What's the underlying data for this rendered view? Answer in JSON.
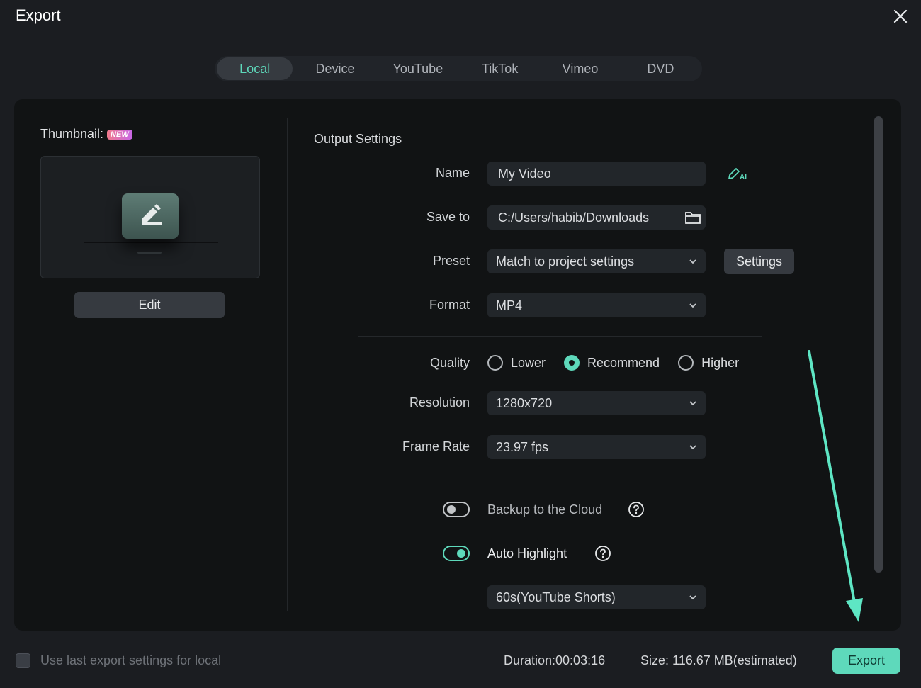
{
  "window": {
    "title": "Export",
    "close_icon": "close-icon"
  },
  "tabs": [
    {
      "label": "Local",
      "active": true
    },
    {
      "label": "Device",
      "active": false
    },
    {
      "label": "YouTube",
      "active": false
    },
    {
      "label": "TikTok",
      "active": false
    },
    {
      "label": "Vimeo",
      "active": false
    },
    {
      "label": "DVD",
      "active": false
    }
  ],
  "thumbnail": {
    "label": "Thumbnail:",
    "badge": "NEW",
    "edit_label": "Edit",
    "icon": "pencil-edit-icon"
  },
  "output": {
    "section_title": "Output Settings",
    "name": {
      "label": "Name",
      "value": "My Video",
      "ai_icon": "ai-pen-icon"
    },
    "save_to": {
      "label": "Save to",
      "value": "C:/Users/habib/Downloads",
      "icon": "folder-icon"
    },
    "preset": {
      "label": "Preset",
      "value": "Match to project settings",
      "settings_label": "Settings"
    },
    "format": {
      "label": "Format",
      "value": "MP4"
    },
    "quality": {
      "label": "Quality",
      "options": [
        {
          "label": "Lower",
          "selected": false
        },
        {
          "label": "Recommend",
          "selected": true
        },
        {
          "label": "Higher",
          "selected": false
        }
      ]
    },
    "resolution": {
      "label": "Resolution",
      "value": "1280x720"
    },
    "frame_rate": {
      "label": "Frame Rate",
      "value": "23.97 fps"
    },
    "backup_cloud": {
      "label": "Backup to the Cloud",
      "enabled": false
    },
    "auto_highlight": {
      "label": "Auto Highlight",
      "enabled": true,
      "duration_value": "60s(YouTube Shorts)"
    }
  },
  "footer": {
    "use_last_label": "Use last export settings for local",
    "use_last_checked": false,
    "duration": "Duration:00:03:16",
    "size": "Size: 116.67 MB(estimated)",
    "export_label": "Export"
  },
  "colors": {
    "accent": "#5ed9bb",
    "background": "#1b1d21",
    "panel": "#111314",
    "field": "#22262a"
  }
}
